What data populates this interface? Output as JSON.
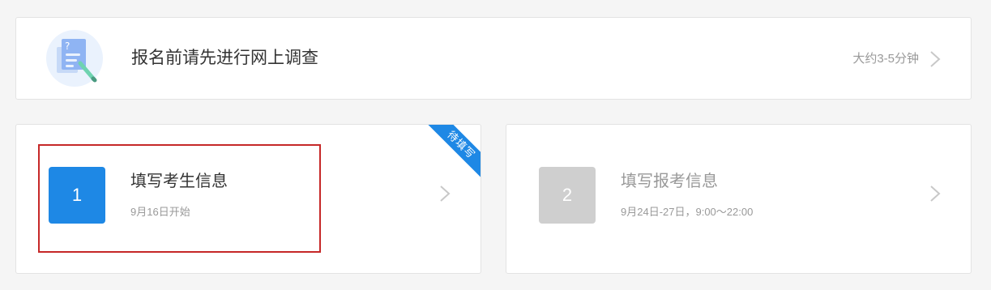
{
  "survey": {
    "title": "报名前请先进行网上调查",
    "duration": "大约3-5分钟"
  },
  "steps": [
    {
      "number": "1",
      "title": "填写考生信息",
      "date": "9月16日开始",
      "badge": "待填写",
      "state": "active"
    },
    {
      "number": "2",
      "title": "填写报考信息",
      "date": "9月24日-27日，9:00～22:00",
      "state": "disabled"
    }
  ],
  "colors": {
    "accent": "#1e88e5",
    "disabled": "#cfcfcf",
    "highlight": "#c62828",
    "background": "#f5f5f5"
  },
  "icons": {
    "survey": "survey-document-pen-icon",
    "arrow": "chevron-right-icon"
  }
}
